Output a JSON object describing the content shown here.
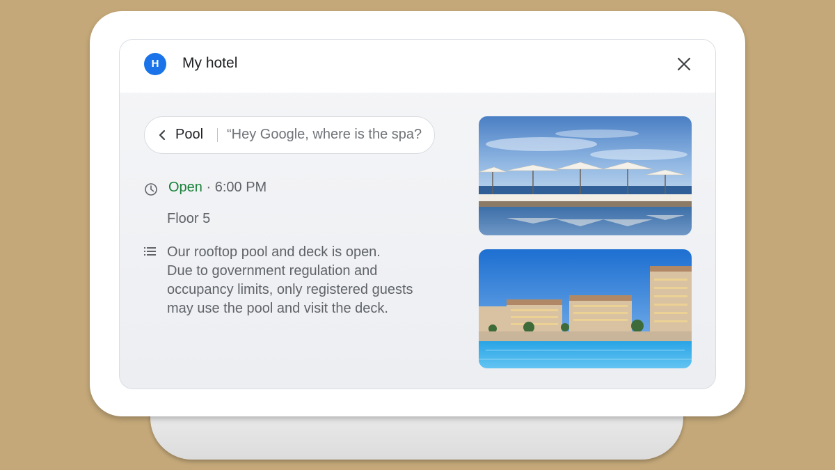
{
  "app": {
    "avatar_letter": "H",
    "title": "My hotel"
  },
  "chip": {
    "label": "Pool",
    "query": "“Hey Google, where is the spa?"
  },
  "info": {
    "status": "Open",
    "hours": " · 6:00 PM",
    "floor": "Floor 5",
    "description_lines": [
      "Our rooftop pool and deck is open.",
      "Due to government regulation and",
      "occupancy limits, only registered guests",
      "may use the pool and visit the deck."
    ]
  },
  "icons": {
    "close": "close-icon",
    "back": "chevron-left-icon",
    "clock": "clock-icon",
    "list": "list-icon"
  },
  "colors": {
    "background": "#c4a879",
    "avatar": "#1a73e8",
    "open_status": "#188038",
    "text_secondary": "#5f6368"
  }
}
